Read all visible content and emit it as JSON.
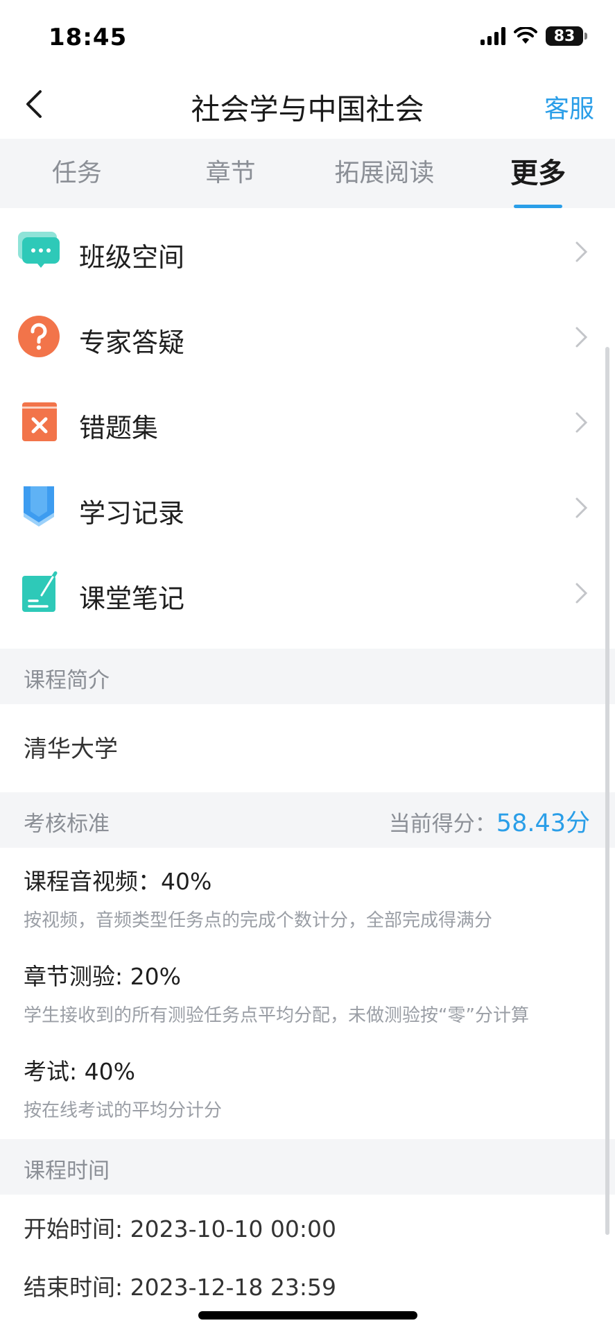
{
  "status": {
    "time": "18:45",
    "battery": "83"
  },
  "nav": {
    "title": "社会学与中国社会",
    "service": "客服"
  },
  "tabs": [
    {
      "label": "任务"
    },
    {
      "label": "章节"
    },
    {
      "label": "拓展阅读"
    },
    {
      "label": "更多",
      "active": true
    }
  ],
  "menu": [
    {
      "label": "班级空间",
      "icon": "chat-bubble-icon"
    },
    {
      "label": "专家答疑",
      "icon": "question-icon"
    },
    {
      "label": "错题集",
      "icon": "wrong-book-icon"
    },
    {
      "label": "学习记录",
      "icon": "bookmark-icon"
    },
    {
      "label": "课堂笔记",
      "icon": "note-pen-icon"
    }
  ],
  "intro": {
    "title": "课程简介",
    "content": "清华大学"
  },
  "assessment": {
    "title": "考核标准",
    "score_label": "当前得分：",
    "score_value": "58.43分",
    "criteria": [
      {
        "title": "课程音视频：40%",
        "desc": "按视频，音频类型任务点的完成个数计分，全部完成得满分"
      },
      {
        "title": "章节测验: 20%",
        "desc": "学生接收到的所有测验任务点平均分配，未做测验按“零”分计算"
      },
      {
        "title": "考试: 40%",
        "desc": "按在线考试的平均分计分"
      }
    ]
  },
  "course_time": {
    "title": "课程时间",
    "start": "开始时间: 2023-10-10 00:00",
    "end": "结束时间: 2023-12-18 23:59"
  },
  "colors": {
    "accent": "#2a9ee8",
    "teal": "#2ec9b8",
    "orange": "#f2744a",
    "blue": "#3d9cf0"
  }
}
